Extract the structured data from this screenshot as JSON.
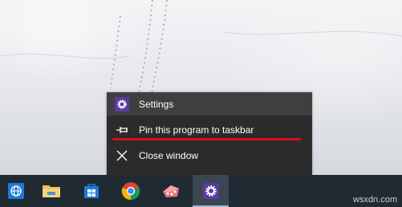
{
  "context_menu": {
    "items": [
      {
        "label": "Settings",
        "icon": "gear-icon"
      },
      {
        "label": "Pin this program to taskbar",
        "icon": "pin-icon"
      },
      {
        "label": "Close window",
        "icon": "close-icon"
      }
    ]
  },
  "taskbar": {
    "buttons": [
      {
        "icon": "network-globe-icon"
      },
      {
        "icon": "file-explorer-folder-icon"
      },
      {
        "icon": "store-icon"
      },
      {
        "icon": "chrome-icon"
      },
      {
        "icon": "app-icon"
      },
      {
        "icon": "settings-gear-icon",
        "active": true
      }
    ]
  },
  "watermark": "wsxdn.com",
  "colors": {
    "menu_bg": "#2b2b2b",
    "menu_hover": "#3f3f3f",
    "taskbar_bg": "#1f2a33",
    "accent_purple": "#5a3aa0",
    "annotation_red": "#d4111b"
  }
}
